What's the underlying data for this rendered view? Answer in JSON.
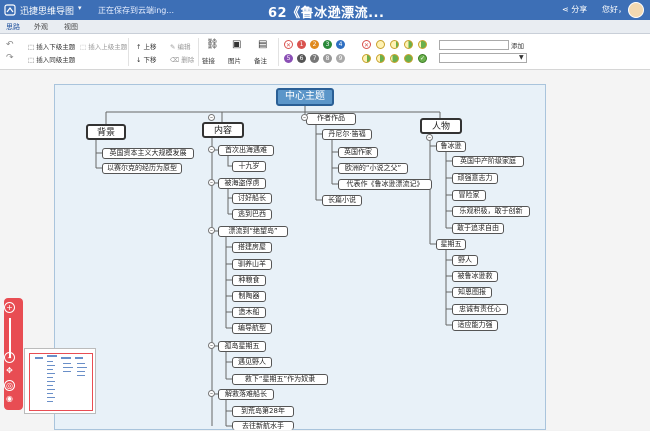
{
  "titlebar": {
    "app_name": "迅捷思维导图",
    "caret": "▾",
    "save_status": "正在保存到云端ing...",
    "document_title": "62《鲁冰逊漂流...",
    "share_label": "分享",
    "greeting": "您好，"
  },
  "tabs": [
    {
      "label": "思路",
      "active": true
    },
    {
      "label": "外观",
      "active": false
    },
    {
      "label": "视图",
      "active": false
    }
  ],
  "toolbar": {
    "insert_sub": "插入下级主题",
    "insert_parent": "插入上级主题",
    "insert_sibling": "插入同级主题",
    "move_up": "上移",
    "move_down": "下移",
    "edit": "编辑",
    "delete": "删除",
    "link": "链接",
    "image": "图片",
    "note": "备注",
    "search_button": "添加",
    "priority_numbers": [
      "1",
      "2",
      "3",
      "4",
      "5",
      "6",
      "7",
      "8",
      "9"
    ],
    "priority_colors": [
      "#d9534f",
      "#e08a1e",
      "#2a8a3a",
      "#2f6fc2",
      "#8a4fb5",
      "#555555",
      "#777777",
      "#999999"
    ]
  },
  "mindmap": {
    "root": "中心主题",
    "branches": {
      "background": "背景",
      "background_items": [
        "英国资本主义大规模发展",
        "以赛尔克的经历为原型"
      ],
      "content": "内容",
      "content_items": {
        "c1": "首次出海遇难",
        "c1a": "十九岁",
        "c2": "被海盗俘虏",
        "c2a": "讨好船长",
        "c2b": "逃到巴西",
        "c3": "漂流到“绝望岛”",
        "c3a": "搭建房屋",
        "c3b": "驯养山羊",
        "c3c": "种粮食",
        "c3d": "制陶器",
        "c3e": "造木船",
        "c3f": "编导航型",
        "c4": "孤岛星期五",
        "c4a": "遇见野人",
        "c4b": "救下“星期五”作为奴隶",
        "c5": "解救落难船长",
        "c5a": "到荒岛第28年",
        "c5b": "去往新航水手"
      },
      "author": "作者作品",
      "author_items": {
        "a1": "丹尼尔·笛福",
        "a1a": "英国作家",
        "a1b": "欧洲的“小说之父”",
        "a1c": "代表作《鲁冰逊漂流记》",
        "a2": "长篇小说"
      },
      "people": "人物",
      "people_items": {
        "p1": "鲁冰逊",
        "p1a": "英国中产阶级家庭",
        "p1b": "顽强意志力",
        "p1c": "冒险家",
        "p1d": "乐观积极，敢于创新",
        "p1e": "敢于追求自由",
        "p2": "星期五",
        "p2a": "野人",
        "p2b": "被鲁冰逊救",
        "p2c": "知恩图报",
        "p2d": "忠诚有责任心",
        "p2e": "适应能力强"
      }
    }
  },
  "colors": {
    "titlebar": "#3d6fb6",
    "root_fill": "#5b96c9",
    "frame_fill": "#e8f1f8",
    "navigator": "#e84d53"
  }
}
